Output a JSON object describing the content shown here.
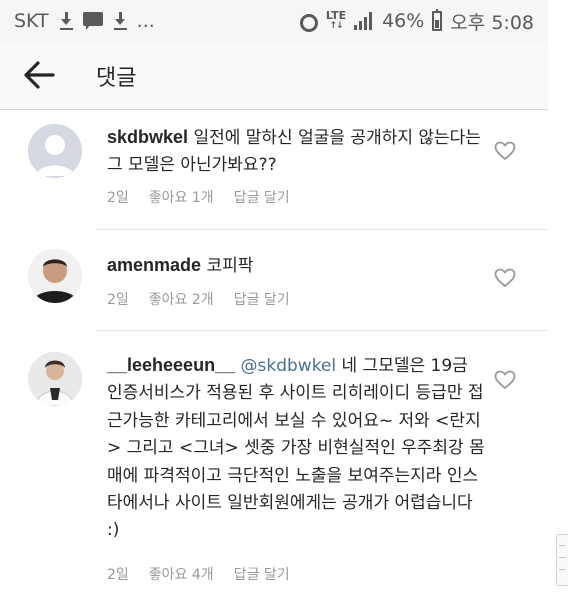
{
  "status_bar": {
    "carrier": "SKT",
    "overflow": "...",
    "network": "LTE",
    "battery": "46%",
    "time": "오후 5:08"
  },
  "header": {
    "title": "댓글"
  },
  "comments": [
    {
      "username": "skdbwkel",
      "text": "일전에 말하신 얼굴을 공개하지 않는다는 그 모델은 아닌가봐요??",
      "time": "2일",
      "likes": "좋아요 1개",
      "reply": "답글 달기"
    },
    {
      "username": "amenmade",
      "text": "코피팍",
      "time": "2일",
      "likes": "좋아요 2개",
      "reply": "답글 달기"
    },
    {
      "username": "__leeheeeun__",
      "mention": "@skdbwkel",
      "text": "네 그모델은 19금 인증서비스가 적용된 후 사이트 리히레이디 등급만 접근가능한 카테고리에서 보실 수 있어요~ 저와 <란지> 그리고 <그녀> 셋중 가장 비현실적인 우주최강 몸매에 파격적이고 극단적인 노출을 보여주는지라 인스타에서나 사이트 일반회원에게는 공개가 어렵습니다 :)",
      "time": "2일",
      "likes": "좋아요 4개",
      "reply": "답글 달기"
    }
  ],
  "colors": {
    "text": "#262626",
    "meta": "#999999",
    "mention": "#4a6f99",
    "header_bg": "#f9f9f9",
    "status_bg": "#f6f6f6"
  }
}
